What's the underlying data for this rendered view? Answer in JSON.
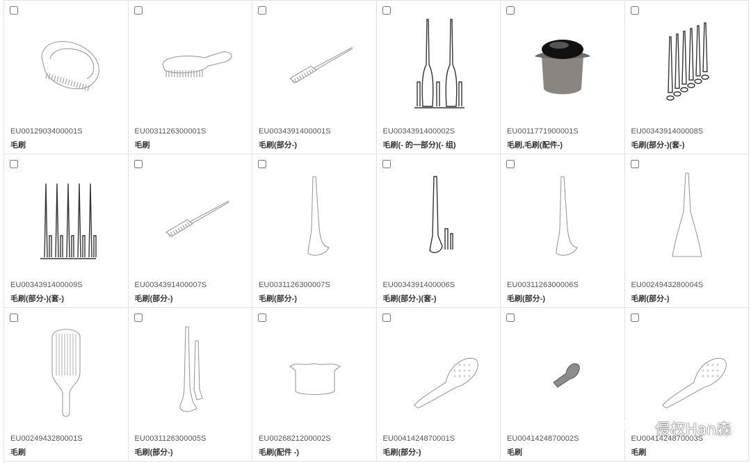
{
  "items": [
    {
      "code": "EU0012903400001S",
      "title": "毛刷",
      "icon": "detangling-brush-icon"
    },
    {
      "code": "EU0031126300001S",
      "title": "毛刷",
      "icon": "handle-brush-icon"
    },
    {
      "code": "EU0034391400001S",
      "title": "毛刷(部分-)",
      "icon": "tail-comb-icon"
    },
    {
      "code": "EU0034391400002S",
      "title": "毛刷(- 的一部分)(- 组)",
      "icon": "twin-spike-set-icon"
    },
    {
      "code": "EU0011771900001S",
      "title": "毛刷,毛刷(配件-)",
      "icon": "brush-cap-photo-icon"
    },
    {
      "code": "EU0034391400008S",
      "title": "毛刷(部分-)(套-)",
      "icon": "perspective-spike-set-icon"
    },
    {
      "code": "EU0034391400009S",
      "title": "毛刷(部分-)(套-)",
      "icon": "spike-rack-icon"
    },
    {
      "code": "EU0034391400007S",
      "title": "毛刷(部分-)",
      "icon": "tail-comb-icon"
    },
    {
      "code": "EU0031126300007S",
      "title": "毛刷(部分-)",
      "icon": "single-spike-icon"
    },
    {
      "code": "EU0034391400006S",
      "title": "毛刷(部分-)(套-)",
      "icon": "spike-pair-icon"
    },
    {
      "code": "EU0031126300006S",
      "title": "毛刷(部分-)",
      "icon": "single-spike-icon"
    },
    {
      "code": "EU0024943280004S",
      "title": "毛刷(部分-)",
      "icon": "cone-spike-icon"
    },
    {
      "code": "EU0024943280001S",
      "title": "毛刷",
      "icon": "paddle-brush-icon"
    },
    {
      "code": "EU0031126300005S",
      "title": "毛刷(部分-)",
      "icon": "double-spike-icon"
    },
    {
      "code": "EU0026821200002S",
      "title": "毛刷(配件 -)",
      "icon": "brush-cap-outline-icon"
    },
    {
      "code": "EU0041424870001S",
      "title": "毛刷(部分-)",
      "icon": "oval-brush-icon"
    },
    {
      "code": "EU0041424870002S",
      "title": "毛刷",
      "icon": "mini-brush-icon"
    },
    {
      "code": "EU0041424870003S",
      "title": "毛刷",
      "icon": "oval-brush-icon"
    }
  ],
  "watermark": {
    "text": "侵权Han森",
    "icon": "wechat-icon"
  }
}
